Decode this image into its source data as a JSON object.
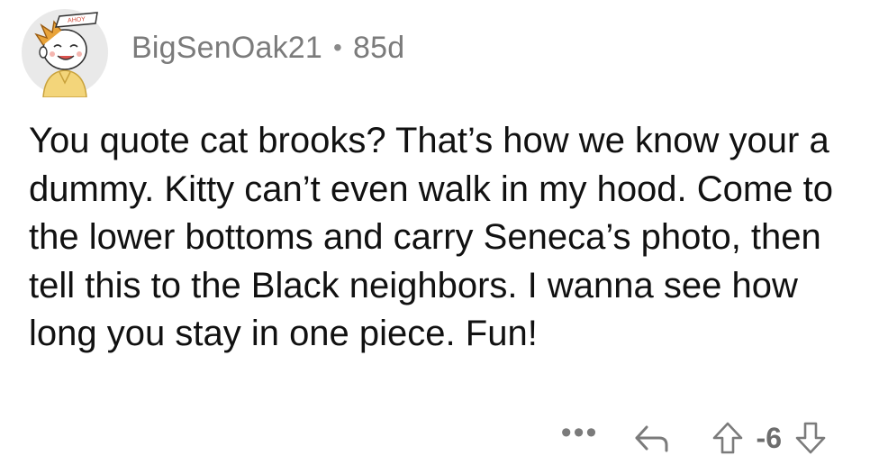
{
  "comment": {
    "username": "BigSenOak21",
    "separator": "•",
    "age": "85d",
    "avatar_badge_text": "AHOY",
    "body": "You quote cat brooks?  That’s how we know your a dummy.  Kitty can’t even walk in my hood.  Come to the lower bottoms and carry Seneca’s photo, then tell this to the Black neighbors. I wanna see how long you stay in one piece. Fun!"
  },
  "actions": {
    "more_label": "•••",
    "vote_score": "-6",
    "icons": {
      "reply": "reply-arrow-icon",
      "upvote": "upvote-arrow-icon",
      "downvote": "downvote-arrow-icon"
    }
  }
}
